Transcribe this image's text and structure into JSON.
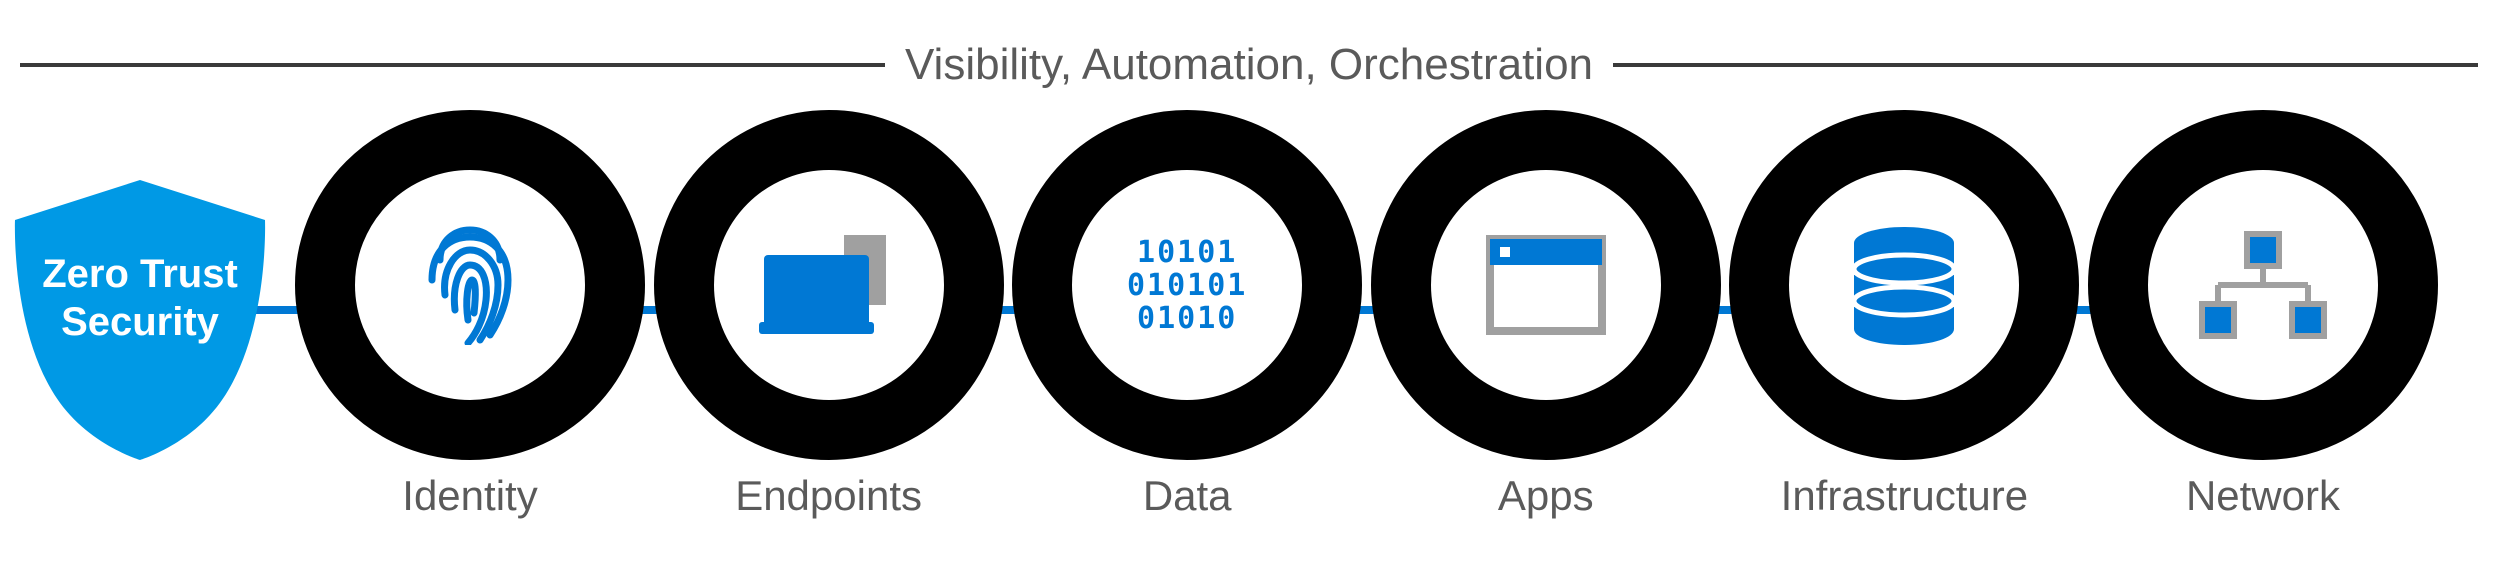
{
  "header": {
    "title": "Visibility, Automation, Orchestration"
  },
  "shield": {
    "line1": "Zero Trust",
    "line2": "Security"
  },
  "pillars": [
    {
      "id": "identity",
      "label": "Identity",
      "icon": "fingerprint-icon"
    },
    {
      "id": "endpoints",
      "label": "Endpoints",
      "icon": "devices-icon"
    },
    {
      "id": "data",
      "label": "Data",
      "icon": "binary-icon",
      "binary": [
        "10101",
        "010101",
        "01010"
      ]
    },
    {
      "id": "apps",
      "label": "Apps",
      "icon": "window-icon"
    },
    {
      "id": "infrastructure",
      "label": "Infrastructure",
      "icon": "database-icon"
    },
    {
      "id": "network",
      "label": "Network",
      "icon": "network-icon"
    }
  ],
  "colors": {
    "accent": "#0078d4",
    "ring": "#000000",
    "text": "#5a5a5a",
    "icon_secondary": "#a0a0a0"
  }
}
